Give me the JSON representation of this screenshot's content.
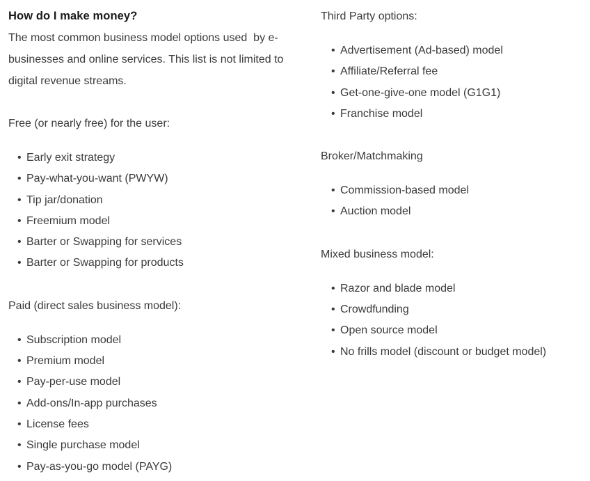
{
  "document": {
    "heading": "How do I make money?",
    "intro": "The most common business model options used  by e-businesses and online services. This list is not limited to digital revenue streams.",
    "bullet_glyph": "•",
    "colors": {
      "background": "#ffffff",
      "heading_text": "#1a1a1a",
      "body_text": "#3a3a3a"
    }
  },
  "left_column": {
    "sections": [
      {
        "label": "Free (or nearly free) for the user:",
        "items": [
          "Early exit strategy",
          "Pay-what-you-want (PWYW)",
          "Tip jar/donation",
          "Freemium model",
          "Barter or Swapping for services",
          "Barter or Swapping for products"
        ]
      },
      {
        "label": "Paid (direct sales business model):",
        "items": [
          "Subscription model",
          "Premium model",
          "Pay-per-use model",
          "Add-ons/In-app purchases",
          "License fees",
          "Single purchase model",
          "Pay-as-you-go model (PAYG)"
        ]
      }
    ]
  },
  "right_column": {
    "sections": [
      {
        "label": "Third Party options:",
        "items": [
          "Advertisement (Ad-based) model",
          "Affiliate/Referral fee",
          "Get-one-give-one model (G1G1)",
          "Franchise model"
        ]
      },
      {
        "label": "Broker/Matchmaking",
        "items": [
          "Commission-based model",
          "Auction model"
        ]
      },
      {
        "label": "Mixed business model:",
        "items": [
          "Razor and blade model",
          "Crowdfunding",
          "Open source model",
          "No frills model (discount or budget model)"
        ]
      }
    ]
  }
}
